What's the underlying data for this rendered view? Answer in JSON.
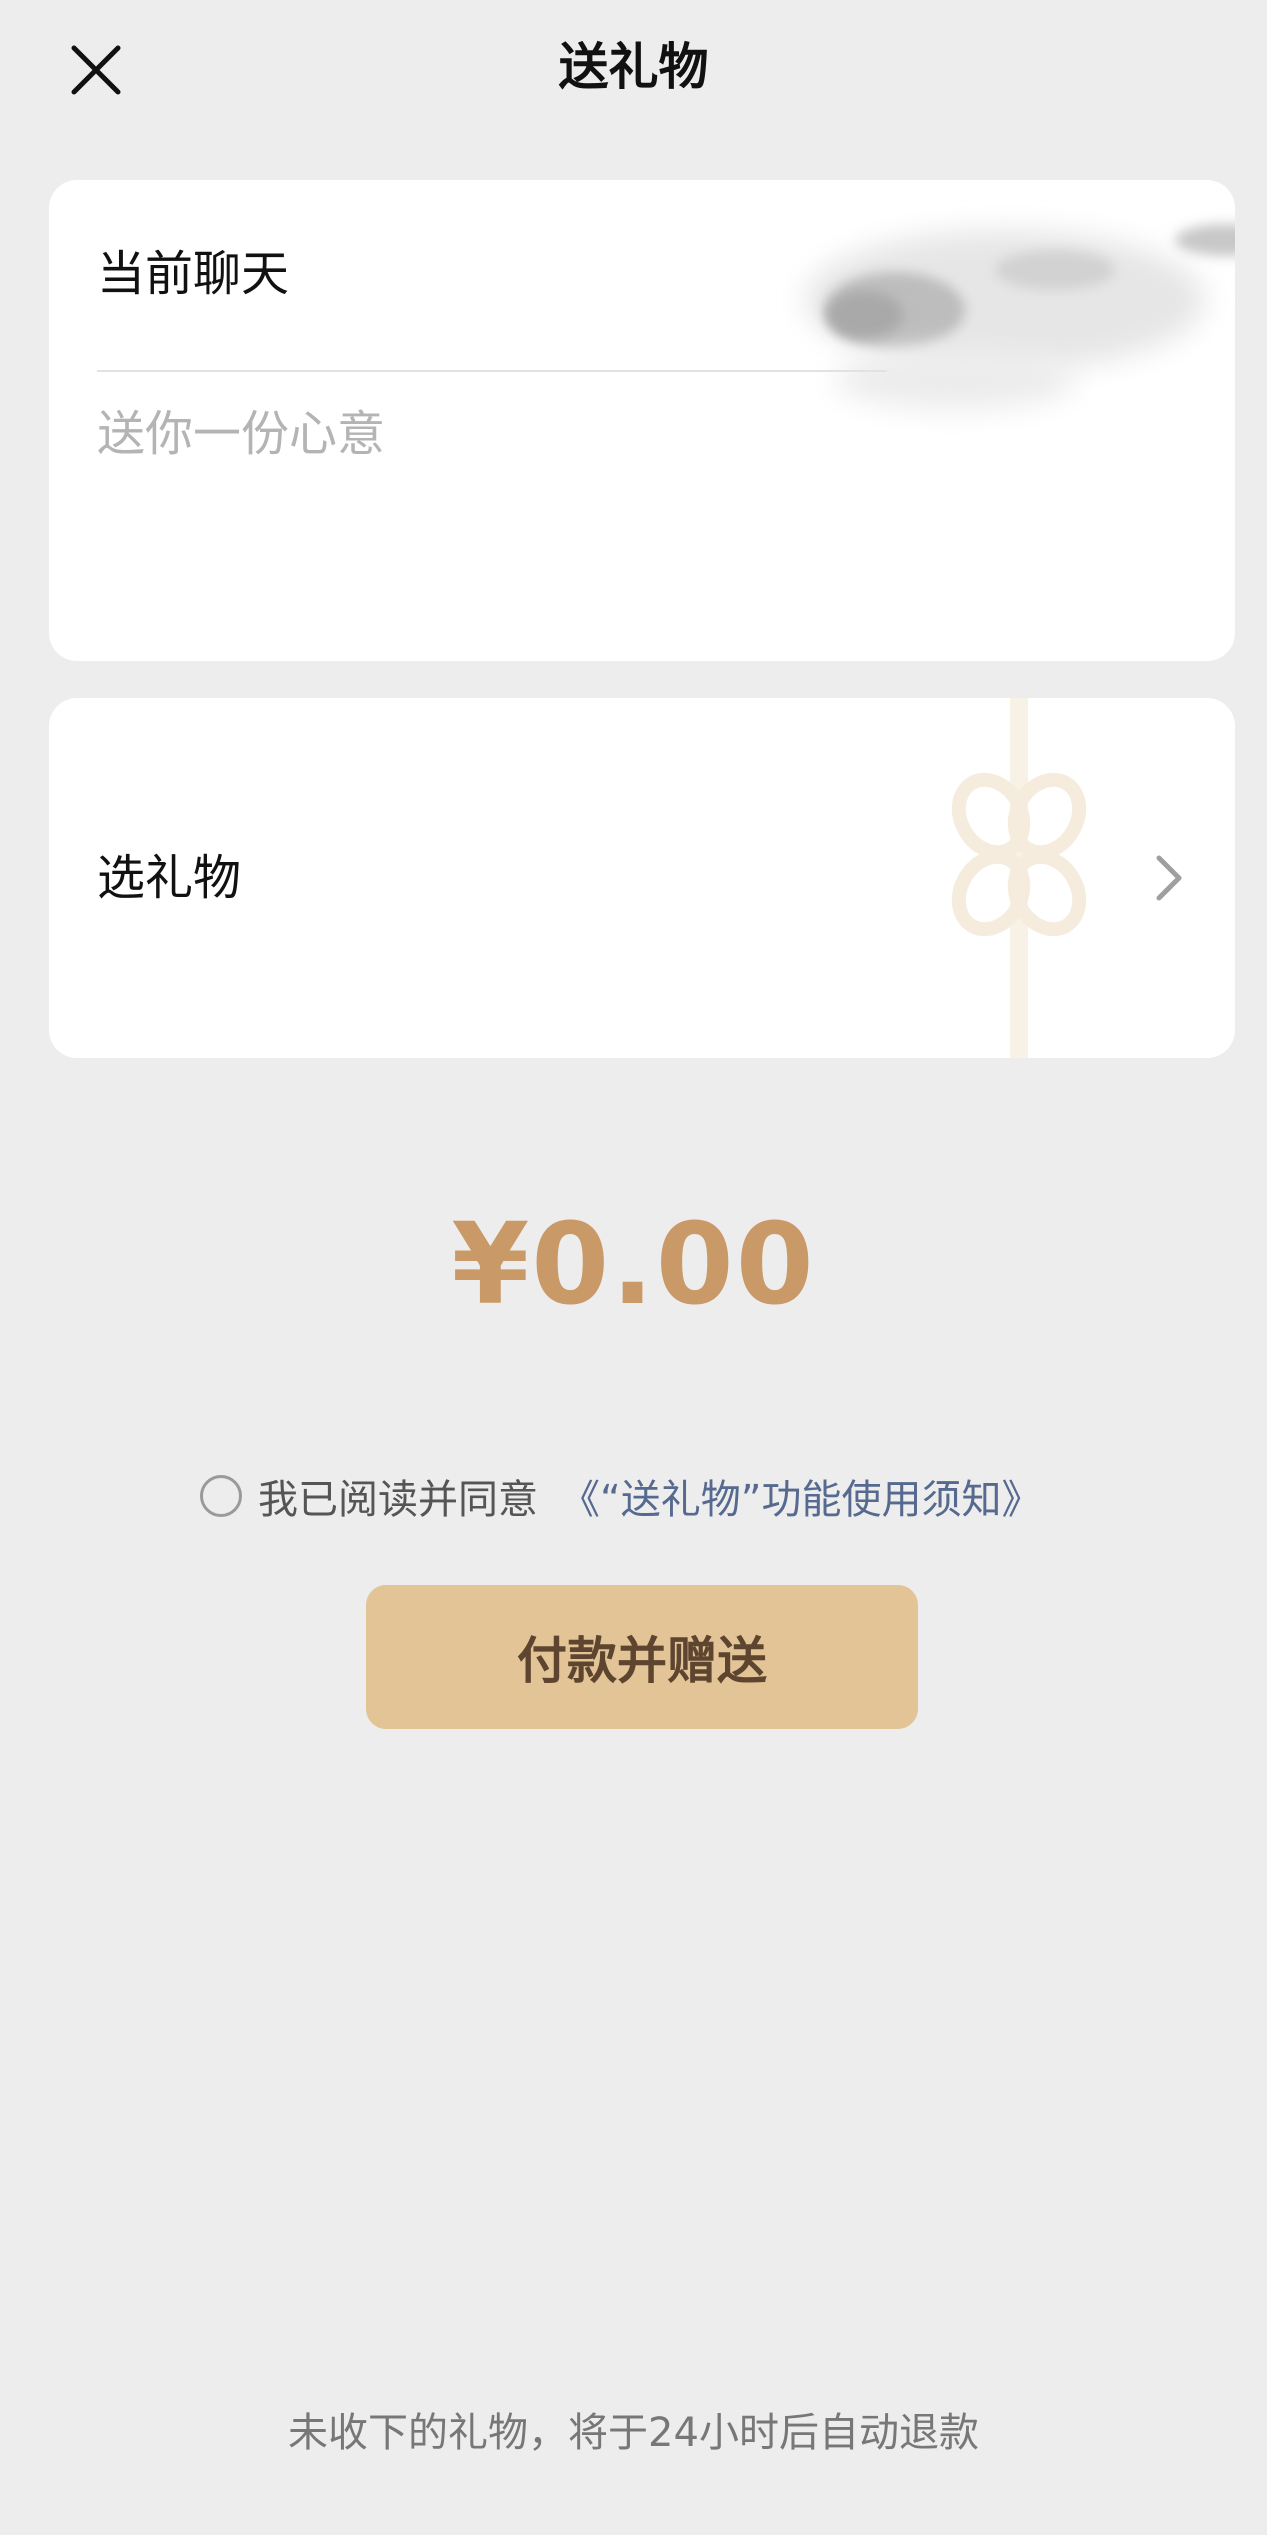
{
  "header": {
    "title": "送礼物",
    "close_icon": "close-icon"
  },
  "message_card": {
    "chat_label": "当前聊天",
    "message_placeholder": "送你一份心意",
    "message_value": ""
  },
  "gift_card": {
    "label": "选礼物",
    "chevron_icon": "chevron-right-icon",
    "decoration_icon": "ribbon-bow-icon"
  },
  "amount": {
    "display": "¥0.00",
    "color": "#c99a68"
  },
  "agreement": {
    "checked": false,
    "text": "我已阅读并同意",
    "link_text": "《“送礼物”功能使用须知》",
    "link_color": "#56698f"
  },
  "pay_button": {
    "label": "付款并赠送",
    "background": "#e2c496"
  },
  "footer": {
    "note": "未收下的礼物，将于24小时后自动退款"
  }
}
